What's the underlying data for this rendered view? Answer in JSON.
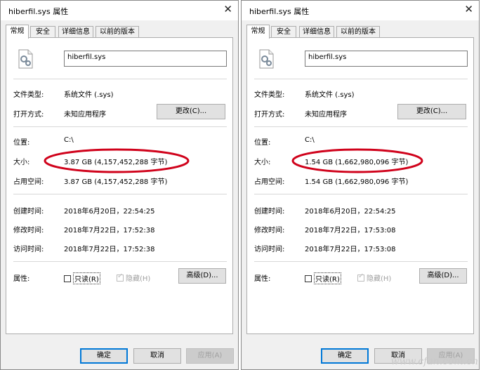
{
  "dialogs": [
    {
      "title": "hiberfil.sys 属性",
      "close_glyph": "✕",
      "tabs": [
        "常规",
        "安全",
        "详细信息",
        "以前的版本"
      ],
      "filename": "hiberfil.sys",
      "file_type": {
        "label": "文件类型:",
        "value": "系统文件 (.sys)"
      },
      "opens_with": {
        "label": "打开方式:",
        "value": "未知应用程序",
        "button": "更改(C)..."
      },
      "location": {
        "label": "位置:",
        "value": "C:\\"
      },
      "size": {
        "label": "大小:",
        "value": "3.87 GB (4,157,452,288 字节)"
      },
      "size_on_disk": {
        "label": "占用空间:",
        "value": "3.87 GB (4,157,452,288 字节)"
      },
      "created": {
        "label": "创建时间:",
        "value": "2018年6月20日，22:54:25"
      },
      "modified": {
        "label": "修改时间:",
        "value": "2018年7月22日，17:52:38"
      },
      "accessed": {
        "label": "访问时间:",
        "value": "2018年7月22日，17:52:38"
      },
      "attributes": {
        "label": "属性:",
        "readonly": "只读(R)",
        "hidden": "隐藏(H)",
        "advanced": "高级(D)..."
      },
      "buttons": {
        "ok": "确定",
        "cancel": "取消",
        "apply": "应用(A)"
      },
      "highlight_color": "#d0021b"
    },
    {
      "title": "hiberfil.sys 属性",
      "close_glyph": "✕",
      "tabs": [
        "常规",
        "安全",
        "详细信息",
        "以前的版本"
      ],
      "filename": "hiberfil.sys",
      "file_type": {
        "label": "文件类型:",
        "value": "系统文件 (.sys)"
      },
      "opens_with": {
        "label": "打开方式:",
        "value": "未知应用程序",
        "button": "更改(C)..."
      },
      "location": {
        "label": "位置:",
        "value": "C:\\"
      },
      "size": {
        "label": "大小:",
        "value": "1.54 GB (1,662,980,096 字节)"
      },
      "size_on_disk": {
        "label": "占用空间:",
        "value": "1.54 GB (1,662,980,096 字节)"
      },
      "created": {
        "label": "创建时间:",
        "value": "2018年6月20日，22:54:25"
      },
      "modified": {
        "label": "修改时间:",
        "value": "2018年7月22日，17:53:08"
      },
      "accessed": {
        "label": "访问时间:",
        "value": "2018年7月22日，17:53:08"
      },
      "attributes": {
        "label": "属性:",
        "readonly": "只读(R)",
        "hidden": "隐藏(H)",
        "advanced": "高级(D)..."
      },
      "buttons": {
        "ok": "确定",
        "cancel": "取消",
        "apply": "应用(A)"
      },
      "highlight_color": "#d0021b"
    }
  ],
  "watermark": "www.cfan.com.cn"
}
